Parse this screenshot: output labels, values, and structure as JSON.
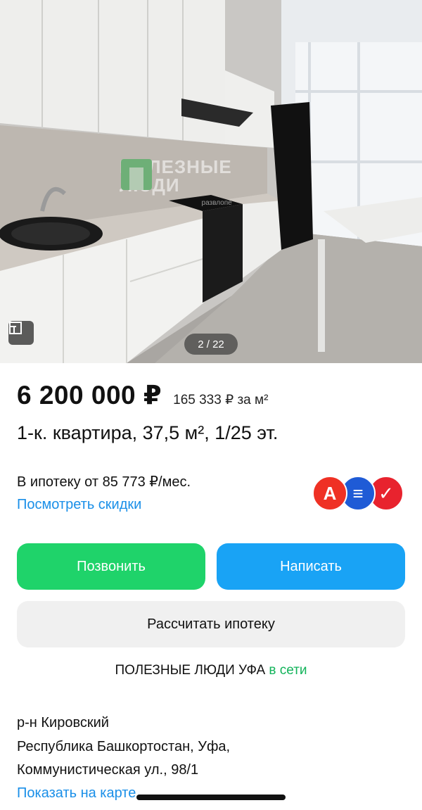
{
  "gallery": {
    "counter": "2 / 22",
    "watermark_line1": "ПОЛЕЗНЫЕ",
    "watermark_line2": "ЛЮДИ",
    "watermark_sub": "развлопе",
    "floorplan_icon": "floorplan-icon"
  },
  "listing": {
    "price": "6 200 000 ₽",
    "price_per_m2": "165 333 ₽ за м²",
    "title": "1-к. квартира, 37,5 м², 1/25 эт."
  },
  "mortgage": {
    "text": "В ипотеку от 85 773 ₽/мес.",
    "link": "Посмотреть скидки",
    "banks": [
      {
        "icon": "alfa-bank-icon",
        "letter": "А",
        "color": "#ef3124"
      },
      {
        "icon": "bank-blue-icon",
        "letter": "≡",
        "color": "#1f5bd6"
      },
      {
        "icon": "bank-red-icon",
        "letter": "✓",
        "color": "#e8232e"
      }
    ]
  },
  "actions": {
    "call": "Позвонить",
    "write": "Написать",
    "calc": "Рассчитать ипотеку"
  },
  "seller": {
    "name": "ПОЛЕЗНЫЕ ЛЮДИ УФА",
    "status": "в сети"
  },
  "address": {
    "district": "р-н Кировский",
    "line1": "Республика Башкортостан, Уфа,",
    "line2": "Коммунистическая ул., 98/1",
    "map_link": "Показать на карте"
  },
  "colors": {
    "call": "#1fd36a",
    "write": "#19a3f5",
    "link": "#1a8fe8",
    "online": "#12b35a"
  }
}
